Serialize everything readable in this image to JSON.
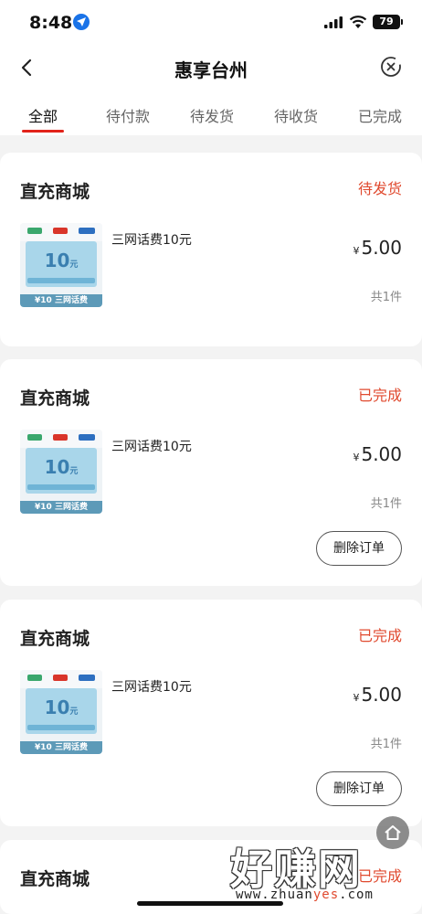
{
  "status_bar": {
    "time": "8:48",
    "battery": "79"
  },
  "nav": {
    "title": "惠享台州"
  },
  "tabs": [
    {
      "label": "全部",
      "active": true
    },
    {
      "label": "待付款",
      "active": false
    },
    {
      "label": "待发货",
      "active": false
    },
    {
      "label": "待收货",
      "active": false
    },
    {
      "label": "已完成",
      "active": false
    }
  ],
  "orders": [
    {
      "store": "直充商城",
      "status": "待发货",
      "product": "三网话费10元",
      "currency": "¥",
      "price": "5.00",
      "quantity": "共1件",
      "action": ""
    },
    {
      "store": "直充商城",
      "status": "已完成",
      "product": "三网话费10元",
      "currency": "¥",
      "price": "5.00",
      "quantity": "共1件",
      "action": "删除订单"
    },
    {
      "store": "直充商城",
      "status": "已完成",
      "product": "三网话费10元",
      "currency": "¥",
      "price": "5.00",
      "quantity": "共1件",
      "action": "删除订单"
    },
    {
      "store": "直充商城",
      "status": "已完成"
    }
  ],
  "thumbnail": {
    "value": "10",
    "unit": "元",
    "footer": "¥10 三网话费"
  },
  "watermark": {
    "text": "好赚网",
    "url_prefix": "www.zhuan",
    "url_highlight": "yes",
    "url_suffix": ".com"
  },
  "colors": {
    "accent": "#e2231a",
    "status": "#e04a2f"
  }
}
